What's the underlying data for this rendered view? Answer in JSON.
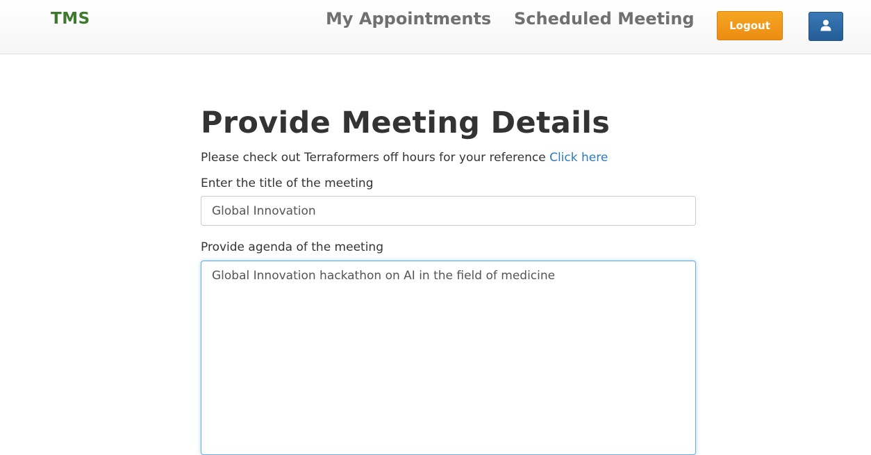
{
  "navbar": {
    "brand": "TMS",
    "links": [
      {
        "label": "My Appointments"
      },
      {
        "label": "Scheduled Meeting"
      }
    ],
    "logout_label": "Logout",
    "user_icon": "user-icon"
  },
  "form": {
    "title": "Provide Meeting Details",
    "info_text": "Please check out Terraformers off hours for your reference ",
    "info_link": "Click here",
    "title_label": "Enter the title of the meeting",
    "title_value": "Global Innovation",
    "agenda_label": "Provide agenda of the meeting",
    "agenda_value": "Global Innovation hackathon on AI in the field of medicine"
  },
  "colors": {
    "brand": "#3e7a2e",
    "logout": "#ec8c12",
    "user_button": "#245d96",
    "link": "#2a7bc0"
  }
}
